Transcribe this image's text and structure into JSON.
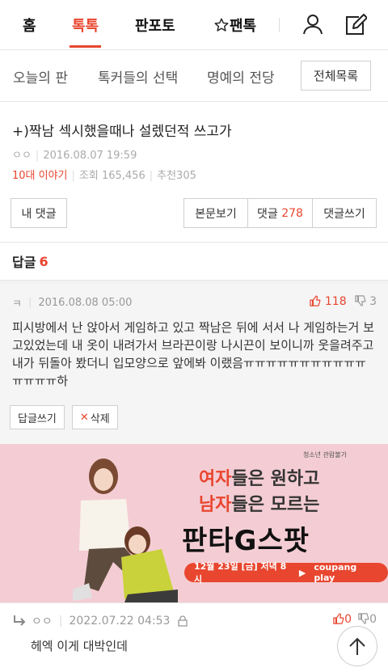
{
  "topnav": {
    "tabs": [
      "홈",
      "톡톡",
      "판포토",
      "팬톡"
    ],
    "active": "톡톡"
  },
  "subnav": {
    "items": [
      "오늘의 판",
      "톡커들의 선택",
      "명예의 전당"
    ],
    "all_button": "전체목록"
  },
  "post": {
    "title": "+)짝남 섹시했을때나 설렜던적 쓰고가",
    "author": "ㅇㅇ",
    "date": "2016.08.07 19:59",
    "category": "10대 이야기",
    "views_label": "조회",
    "views": "165,456",
    "recommend_label": "추천",
    "recommend": "305",
    "my_comments_button": "내 댓글",
    "view_body_button": "본문보기",
    "comments_button_label": "댓글",
    "comments_count": "278",
    "write_comment_button": "댓글쓰기"
  },
  "replies_header": {
    "label": "답글",
    "count": "6"
  },
  "comment": {
    "author": "ㅋ",
    "date": "2016.08.08 05:00",
    "up": "118",
    "down": "3",
    "body": "피시방에서 난 앉아서 게임하고 있고 짝남은 뒤에 서서 나 게임하는거 보고있었는데 내 옷이 내려가서 브라끈이랑 나시끈이 보이니까 웃을려주고 내가 뒤돌아 봤더니 입모양으로 앞에봐 이랬음ㅠㅠㅠㅠㅠㅠㅠㅠㅠㅠㅠㅠㅠㅠㅠ하",
    "reply_button": "답글쓰기",
    "delete_button": "삭제"
  },
  "ad": {
    "rating": "청소년 관람불가",
    "line1_highlight": "여자",
    "line1_rest": "들은 원하고",
    "line2_highlight": "남자",
    "line2_rest": "들은 모르는",
    "logo": "판타G스팟",
    "date": "12월 23일 [금] 저녁 8시",
    "platform": "coupang play"
  },
  "reply": {
    "author": "ㅇㅇ",
    "date": "2022.07.22 04:53",
    "up": "0",
    "down": "0",
    "body": "헤엑 이게 대박인데"
  },
  "colors": {
    "accent": "#e8462f",
    "ad_bg": "#f4cdd4",
    "comment_bg": "#f5f5f5"
  }
}
